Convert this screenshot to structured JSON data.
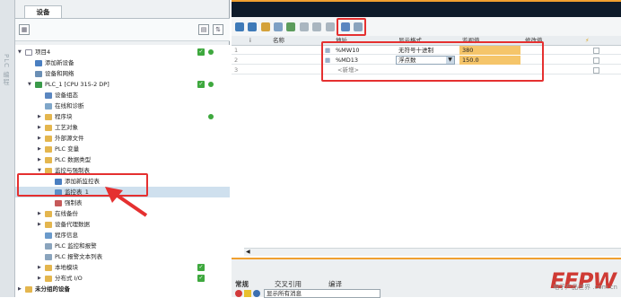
{
  "left_panel": {
    "tab": "设备",
    "tree": [
      {
        "label": "项目4",
        "level": 0
      },
      {
        "label": "添加新设备",
        "level": 1
      },
      {
        "label": "设备和网络",
        "level": 1
      },
      {
        "label": "PLC_1 [CPU 315-2 DP]",
        "level": 1
      },
      {
        "label": "设备组态",
        "level": 2
      },
      {
        "label": "在线和诊断",
        "level": 2
      },
      {
        "label": "程序块",
        "level": 2
      },
      {
        "label": "工艺对象",
        "level": 2
      },
      {
        "label": "外部源文件",
        "level": 2
      },
      {
        "label": "PLC 变量",
        "level": 2
      },
      {
        "label": "PLC 数据类型",
        "level": 2
      },
      {
        "label": "监控与强制表",
        "level": 2
      },
      {
        "label": "添加新监控表",
        "level": 3
      },
      {
        "label": "监控表_1",
        "level": 3
      },
      {
        "label": "强制表",
        "level": 3
      },
      {
        "label": "在线备份",
        "level": 2
      },
      {
        "label": "设备代理数据",
        "level": 2
      },
      {
        "label": "程序信息",
        "level": 2
      },
      {
        "label": "PLC 监控和报警",
        "level": 2
      },
      {
        "label": "PLC 报警文本列表",
        "level": 2
      },
      {
        "label": "本地模块",
        "level": 2
      },
      {
        "label": "分布式 I/O",
        "level": 2
      },
      {
        "label": "未分组的设备",
        "level": 0
      }
    ]
  },
  "grid": {
    "headers": [
      "i",
      "名称",
      "地址",
      "显示格式",
      "监视值",
      "修改值"
    ],
    "rows": [
      {
        "num": "1",
        "address": "%MW10",
        "format": "无符号十进制",
        "value": "380"
      },
      {
        "num": "2",
        "address": "%MD13",
        "format": "浮点数",
        "value": "150.0"
      },
      {
        "num": "3",
        "address": "<新增>",
        "format": "",
        "value": ""
      }
    ]
  },
  "bottom": {
    "tabs": [
      "常规",
      "交叉引用",
      "编译"
    ],
    "status": "显示所有消息"
  },
  "watermark": {
    "brand": "EEPW",
    "site": "电子产品世界 .com.cn"
  },
  "colors": {
    "accent": "#f0a030",
    "annotation": "#e53030"
  }
}
